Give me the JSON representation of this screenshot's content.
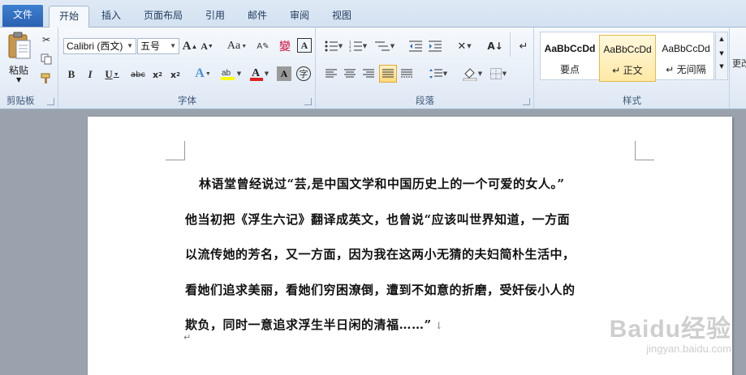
{
  "tabs": [
    {
      "label": "文件",
      "kind": "file"
    },
    {
      "label": "开始",
      "kind": "active"
    },
    {
      "label": "插入",
      "kind": "normal"
    },
    {
      "label": "页面布局",
      "kind": "normal"
    },
    {
      "label": "引用",
      "kind": "normal"
    },
    {
      "label": "邮件",
      "kind": "normal"
    },
    {
      "label": "审阅",
      "kind": "normal"
    },
    {
      "label": "视图",
      "kind": "normal"
    }
  ],
  "ribbon": {
    "clipboard": {
      "paste_label": "粘贴",
      "group_label": "剪贴板"
    },
    "font": {
      "font_name": "Calibri (西文)",
      "font_size": "五号",
      "group_label": "字体",
      "change_case_label": "Aa"
    },
    "paragraph": {
      "group_label": "段落"
    },
    "styles": {
      "group_label": "样式",
      "items": [
        {
          "sample": "AaBbCcDd",
          "name": "要点",
          "selected": false
        },
        {
          "sample": "AaBbCcDd",
          "name": "↵ 正文",
          "selected": true
        },
        {
          "sample": "AaBbCcDd",
          "name": "↵ 无间隔",
          "selected": false
        }
      ],
      "more_label": "更改"
    }
  },
  "document": {
    "lines": [
      "林语堂曾经说过“芸,是中国文学和中国历史上的一个可爱的女人。”",
      "他当初把《浮生六记》翻译成英文，也曾说“应该叫世界知道，一方面",
      "以流传她的芳名，又一方面，因为我在这两小无猜的夫妇简朴生活中，",
      "看她们追求美丽，看她们穷困潦倒，遭到不如意的折磨，受奸佞小人的",
      "欺负，同时一意追求浮生半日闲的清福……”"
    ],
    "paragraph_mark": "↓",
    "empty_para_mark": "↵"
  },
  "watermark": {
    "brand": "Baidu经验",
    "url": "jingyan.baidu.com"
  }
}
